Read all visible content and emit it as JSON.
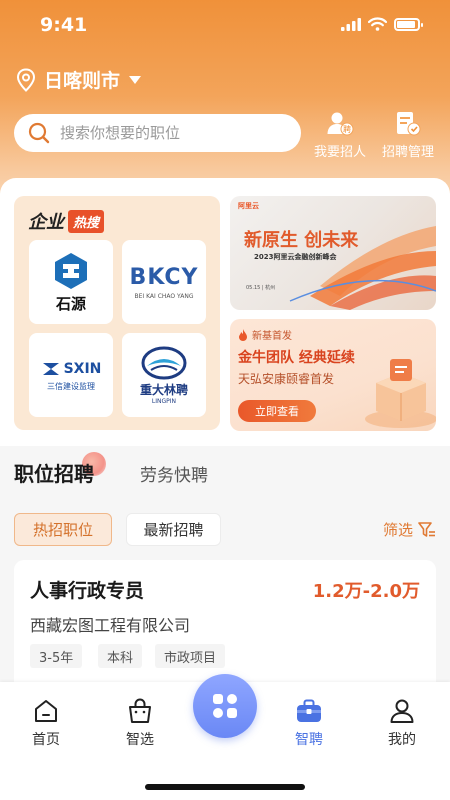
{
  "status_bar": {
    "time": "9:41"
  },
  "location": {
    "city": "日喀则市"
  },
  "search": {
    "placeholder": "搜索你想要的职位"
  },
  "top_actions": [
    {
      "label": "我要招人",
      "icon": "recruit-person-icon"
    },
    {
      "label": "招聘管理",
      "icon": "recruit-manage-icon"
    }
  ],
  "enterprise": {
    "title": "企业",
    "badge": "热搜",
    "companies": [
      {
        "name": "石源",
        "logo": "shiyuan-logo"
      },
      {
        "name": "BKCY",
        "sub": "BEI KAI CHAO YANG",
        "logo": "bkcy-logo"
      },
      {
        "name": "SXIN",
        "sub": "三信建设监理",
        "logo": "sxin-logo"
      },
      {
        "name": "重大林聘",
        "sub": "LINGPIN",
        "logo": "linpin-logo"
      }
    ]
  },
  "banners": {
    "top": {
      "brand": "阿里云",
      "headline": "新原生 创未来",
      "sub": "2023阿里云金融创新峰会",
      "meta": "05.15 | 杭州"
    },
    "bottom": {
      "tag": "新基首发",
      "headline": "金牛团队 经典延续",
      "sub": "天弘安康颐睿首发",
      "button": "立即查看"
    }
  },
  "tabs": {
    "primary": "职位招聘",
    "secondary": "劳务快聘"
  },
  "chips": {
    "hot": "热招职位",
    "latest": "最新招聘",
    "filter": "筛选"
  },
  "job": {
    "title": "人事行政专员",
    "salary": "1.2万-2.0万",
    "company": "西藏宏图工程有限公司",
    "tags": [
      "3-5年",
      "本科",
      "市政项目"
    ]
  },
  "nav": [
    {
      "label": "首页",
      "icon": "home-icon"
    },
    {
      "label": "智选",
      "icon": "shopping-bag-icon"
    },
    {
      "label": "智聘",
      "icon": "briefcase-icon",
      "active": true
    },
    {
      "label": "我的",
      "icon": "user-icon"
    }
  ],
  "colors": {
    "accent": "#f0913a",
    "salary": "#e15b2c",
    "nav_active": "#4a72e2"
  }
}
